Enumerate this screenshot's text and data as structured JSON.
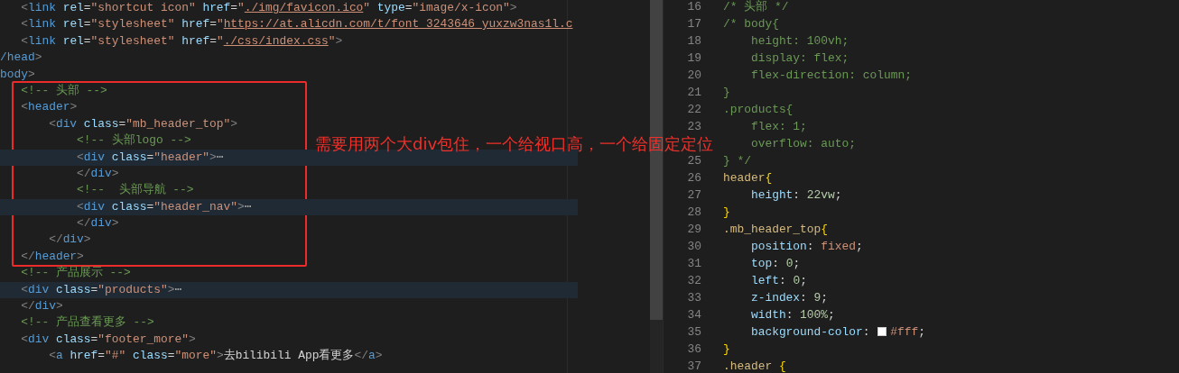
{
  "html_editor": {
    "lines": [
      {
        "folded": false,
        "tokens": [
          {
            "kind": "punct",
            "text": "   <"
          },
          {
            "kind": "tag",
            "text": "link"
          },
          {
            "kind": "attr",
            "text": " rel"
          },
          {
            "kind": "plain",
            "text": "="
          },
          {
            "kind": "string",
            "text": "\"shortcut icon\""
          },
          {
            "kind": "attr",
            "text": " href"
          },
          {
            "kind": "plain",
            "text": "="
          },
          {
            "kind": "string",
            "text": "\""
          },
          {
            "kind": "link",
            "text": "./img/favicon.ico"
          },
          {
            "kind": "string",
            "text": "\""
          },
          {
            "kind": "attr",
            "text": " type"
          },
          {
            "kind": "plain",
            "text": "="
          },
          {
            "kind": "string",
            "text": "\"image/x-icon\""
          },
          {
            "kind": "punct",
            "text": ">"
          }
        ]
      },
      {
        "folded": false,
        "tokens": [
          {
            "kind": "punct",
            "text": "   <"
          },
          {
            "kind": "tag",
            "text": "link"
          },
          {
            "kind": "attr",
            "text": " rel"
          },
          {
            "kind": "plain",
            "text": "="
          },
          {
            "kind": "string",
            "text": "\"stylesheet\""
          },
          {
            "kind": "attr",
            "text": " href"
          },
          {
            "kind": "plain",
            "text": "="
          },
          {
            "kind": "string",
            "text": "\""
          },
          {
            "kind": "link",
            "text": "https://at.alicdn.com/t/font_3243646_yuxzw3nas1l.c"
          }
        ]
      },
      {
        "folded": false,
        "tokens": [
          {
            "kind": "punct",
            "text": "   <"
          },
          {
            "kind": "tag",
            "text": "link"
          },
          {
            "kind": "attr",
            "text": " rel"
          },
          {
            "kind": "plain",
            "text": "="
          },
          {
            "kind": "string",
            "text": "\"stylesheet\""
          },
          {
            "kind": "attr",
            "text": " href"
          },
          {
            "kind": "plain",
            "text": "="
          },
          {
            "kind": "string",
            "text": "\""
          },
          {
            "kind": "link",
            "text": "./css/index.css"
          },
          {
            "kind": "string",
            "text": "\""
          },
          {
            "kind": "punct",
            "text": ">"
          }
        ]
      },
      {
        "folded": false,
        "tokens": [
          {
            "kind": "tag",
            "text": "/head"
          },
          {
            "kind": "punct",
            "text": ">"
          }
        ]
      },
      {
        "folded": false,
        "tokens": [
          {
            "kind": "tag",
            "text": "body"
          },
          {
            "kind": "punct",
            "text": ">"
          }
        ]
      },
      {
        "folded": false,
        "tokens": [
          {
            "kind": "comment",
            "text": "   <!-- 头部 -->"
          }
        ]
      },
      {
        "folded": false,
        "tokens": [
          {
            "kind": "punct",
            "text": "   <"
          },
          {
            "kind": "tag",
            "text": "header"
          },
          {
            "kind": "punct",
            "text": ">"
          }
        ]
      },
      {
        "folded": false,
        "tokens": [
          {
            "kind": "punct",
            "text": "       <"
          },
          {
            "kind": "tag",
            "text": "div"
          },
          {
            "kind": "attr",
            "text": " class"
          },
          {
            "kind": "plain",
            "text": "="
          },
          {
            "kind": "string",
            "text": "\"mb_header_top\""
          },
          {
            "kind": "punct",
            "text": ">"
          }
        ]
      },
      {
        "folded": false,
        "tokens": [
          {
            "kind": "comment",
            "text": "           <!-- 头部logo -->"
          }
        ]
      },
      {
        "folded": true,
        "tokens": [
          {
            "kind": "punct",
            "text": "           <"
          },
          {
            "kind": "tag",
            "text": "div"
          },
          {
            "kind": "attr",
            "text": " class"
          },
          {
            "kind": "plain",
            "text": "="
          },
          {
            "kind": "string",
            "text": "\"header\""
          },
          {
            "kind": "punct",
            "text": ">"
          },
          {
            "kind": "fold",
            "text": "⋯"
          }
        ]
      },
      {
        "folded": false,
        "tokens": [
          {
            "kind": "punct",
            "text": "           </"
          },
          {
            "kind": "tag",
            "text": "div"
          },
          {
            "kind": "punct",
            "text": ">"
          }
        ]
      },
      {
        "folded": false,
        "tokens": [
          {
            "kind": "comment",
            "text": "           <!--  头部导航 -->"
          }
        ]
      },
      {
        "folded": true,
        "tokens": [
          {
            "kind": "punct",
            "text": "           <"
          },
          {
            "kind": "tag",
            "text": "div"
          },
          {
            "kind": "attr",
            "text": " class"
          },
          {
            "kind": "plain",
            "text": "="
          },
          {
            "kind": "string",
            "text": "\"header_nav\""
          },
          {
            "kind": "punct",
            "text": ">"
          },
          {
            "kind": "fold",
            "text": "⋯"
          }
        ]
      },
      {
        "folded": false,
        "tokens": [
          {
            "kind": "punct",
            "text": "           </"
          },
          {
            "kind": "tag",
            "text": "div"
          },
          {
            "kind": "punct",
            "text": ">"
          }
        ]
      },
      {
        "folded": false,
        "tokens": [
          {
            "kind": "punct",
            "text": "       </"
          },
          {
            "kind": "tag",
            "text": "div"
          },
          {
            "kind": "punct",
            "text": ">"
          }
        ]
      },
      {
        "folded": false,
        "tokens": [
          {
            "kind": "punct",
            "text": "   </"
          },
          {
            "kind": "tag",
            "text": "header"
          },
          {
            "kind": "punct",
            "text": ">"
          }
        ]
      },
      {
        "folded": false,
        "tokens": [
          {
            "kind": "comment",
            "text": "   <!-- 产品展示 -->"
          }
        ]
      },
      {
        "folded": true,
        "tokens": [
          {
            "kind": "punct",
            "text": "   <"
          },
          {
            "kind": "tag",
            "text": "div"
          },
          {
            "kind": "attr",
            "text": " class"
          },
          {
            "kind": "plain",
            "text": "="
          },
          {
            "kind": "string",
            "text": "\"products\""
          },
          {
            "kind": "punct",
            "text": ">"
          },
          {
            "kind": "fold",
            "text": "⋯"
          }
        ]
      },
      {
        "folded": false,
        "tokens": [
          {
            "kind": "punct",
            "text": "   </"
          },
          {
            "kind": "tag",
            "text": "div"
          },
          {
            "kind": "punct",
            "text": ">"
          }
        ]
      },
      {
        "folded": false,
        "tokens": [
          {
            "kind": "comment",
            "text": "   <!-- 产品查看更多 -->"
          }
        ]
      },
      {
        "folded": false,
        "tokens": [
          {
            "kind": "punct",
            "text": "   <"
          },
          {
            "kind": "tag",
            "text": "div"
          },
          {
            "kind": "attr",
            "text": " class"
          },
          {
            "kind": "plain",
            "text": "="
          },
          {
            "kind": "string",
            "text": "\"footer_more\""
          },
          {
            "kind": "punct",
            "text": ">"
          }
        ]
      },
      {
        "folded": false,
        "tokens": [
          {
            "kind": "punct",
            "text": "       <"
          },
          {
            "kind": "tag",
            "text": "a"
          },
          {
            "kind": "attr",
            "text": " href"
          },
          {
            "kind": "plain",
            "text": "="
          },
          {
            "kind": "string",
            "text": "\"#\""
          },
          {
            "kind": "attr",
            "text": " class"
          },
          {
            "kind": "plain",
            "text": "="
          },
          {
            "kind": "string",
            "text": "\"more\""
          },
          {
            "kind": "punct",
            "text": ">"
          },
          {
            "kind": "plain",
            "text": "去bilibili App看更多"
          },
          {
            "kind": "punct",
            "text": "</"
          },
          {
            "kind": "tag",
            "text": "a"
          },
          {
            "kind": "punct",
            "text": ">"
          }
        ]
      }
    ]
  },
  "annotation": {
    "text": "需要用两个大div包住，一个给视口高，一个给固定定位"
  },
  "css_editor": {
    "lines": [
      {
        "number": "16",
        "tokens": [
          {
            "kind": "comment",
            "text": "/* 头部 */"
          }
        ]
      },
      {
        "number": "17",
        "tokens": [
          {
            "kind": "comment",
            "text": "/* body{"
          }
        ]
      },
      {
        "number": "18",
        "tokens": [
          {
            "kind": "comment",
            "text": "    height: 100vh;"
          }
        ]
      },
      {
        "number": "19",
        "tokens": [
          {
            "kind": "comment",
            "text": "    display: flex;"
          }
        ]
      },
      {
        "number": "20",
        "tokens": [
          {
            "kind": "comment",
            "text": "    flex-direction: column;"
          }
        ]
      },
      {
        "number": "21",
        "tokens": [
          {
            "kind": "comment",
            "text": "}"
          }
        ]
      },
      {
        "number": "22",
        "tokens": [
          {
            "kind": "comment",
            "text": ".products{"
          }
        ]
      },
      {
        "number": "23",
        "tokens": [
          {
            "kind": "comment",
            "text": "    flex: 1;"
          }
        ]
      },
      {
        "tokens": [
          {
            "kind": "comment",
            "text": "    overflow: auto;"
          }
        ]
      },
      {
        "number": "25",
        "tokens": [
          {
            "kind": "comment",
            "text": "} */"
          }
        ]
      },
      {
        "number": "26",
        "tokens": [
          {
            "kind": "selector",
            "text": "header"
          },
          {
            "kind": "brace",
            "text": "{"
          }
        ]
      },
      {
        "number": "27",
        "tokens": [
          {
            "kind": "property",
            "text": "    height"
          },
          {
            "kind": "plain",
            "text": ": "
          },
          {
            "kind": "number",
            "text": "22vw"
          },
          {
            "kind": "plain",
            "text": ";"
          }
        ]
      },
      {
        "number": "28",
        "tokens": [
          {
            "kind": "brace",
            "text": "}"
          }
        ]
      },
      {
        "number": "29",
        "tokens": [
          {
            "kind": "selector",
            "text": ".mb_header_top"
          },
          {
            "kind": "brace",
            "text": "{"
          }
        ]
      },
      {
        "number": "30",
        "tokens": [
          {
            "kind": "property",
            "text": "    position"
          },
          {
            "kind": "plain",
            "text": ": "
          },
          {
            "kind": "string",
            "text": "fixed"
          },
          {
            "kind": "plain",
            "text": ";"
          }
        ]
      },
      {
        "number": "31",
        "tokens": [
          {
            "kind": "property",
            "text": "    top"
          },
          {
            "kind": "plain",
            "text": ": "
          },
          {
            "kind": "number",
            "text": "0"
          },
          {
            "kind": "plain",
            "text": ";"
          }
        ]
      },
      {
        "number": "32",
        "tokens": [
          {
            "kind": "property",
            "text": "    left"
          },
          {
            "kind": "plain",
            "text": ": "
          },
          {
            "kind": "number",
            "text": "0"
          },
          {
            "kind": "plain",
            "text": ";"
          }
        ]
      },
      {
        "number": "33",
        "tokens": [
          {
            "kind": "property",
            "text": "    z-index"
          },
          {
            "kind": "plain",
            "text": ": "
          },
          {
            "kind": "number",
            "text": "9"
          },
          {
            "kind": "plain",
            "text": ";"
          }
        ]
      },
      {
        "number": "34",
        "tokens": [
          {
            "kind": "property",
            "text": "    width"
          },
          {
            "kind": "plain",
            "text": ": "
          },
          {
            "kind": "number",
            "text": "100%"
          },
          {
            "kind": "plain",
            "text": ";"
          }
        ]
      },
      {
        "number": "35",
        "tokens": [
          {
            "kind": "property",
            "text": "    background-color"
          },
          {
            "kind": "plain",
            "text": ": "
          },
          {
            "kind": "swatch",
            "color": "#ffffff"
          },
          {
            "kind": "string",
            "text": "#fff"
          },
          {
            "kind": "plain",
            "text": ";"
          }
        ]
      },
      {
        "number": "36",
        "tokens": [
          {
            "kind": "brace",
            "text": "}"
          }
        ]
      },
      {
        "number": "37",
        "tokens": [
          {
            "kind": "selector",
            "text": ".header"
          },
          {
            "kind": "brace",
            "text": " {"
          }
        ]
      }
    ]
  }
}
